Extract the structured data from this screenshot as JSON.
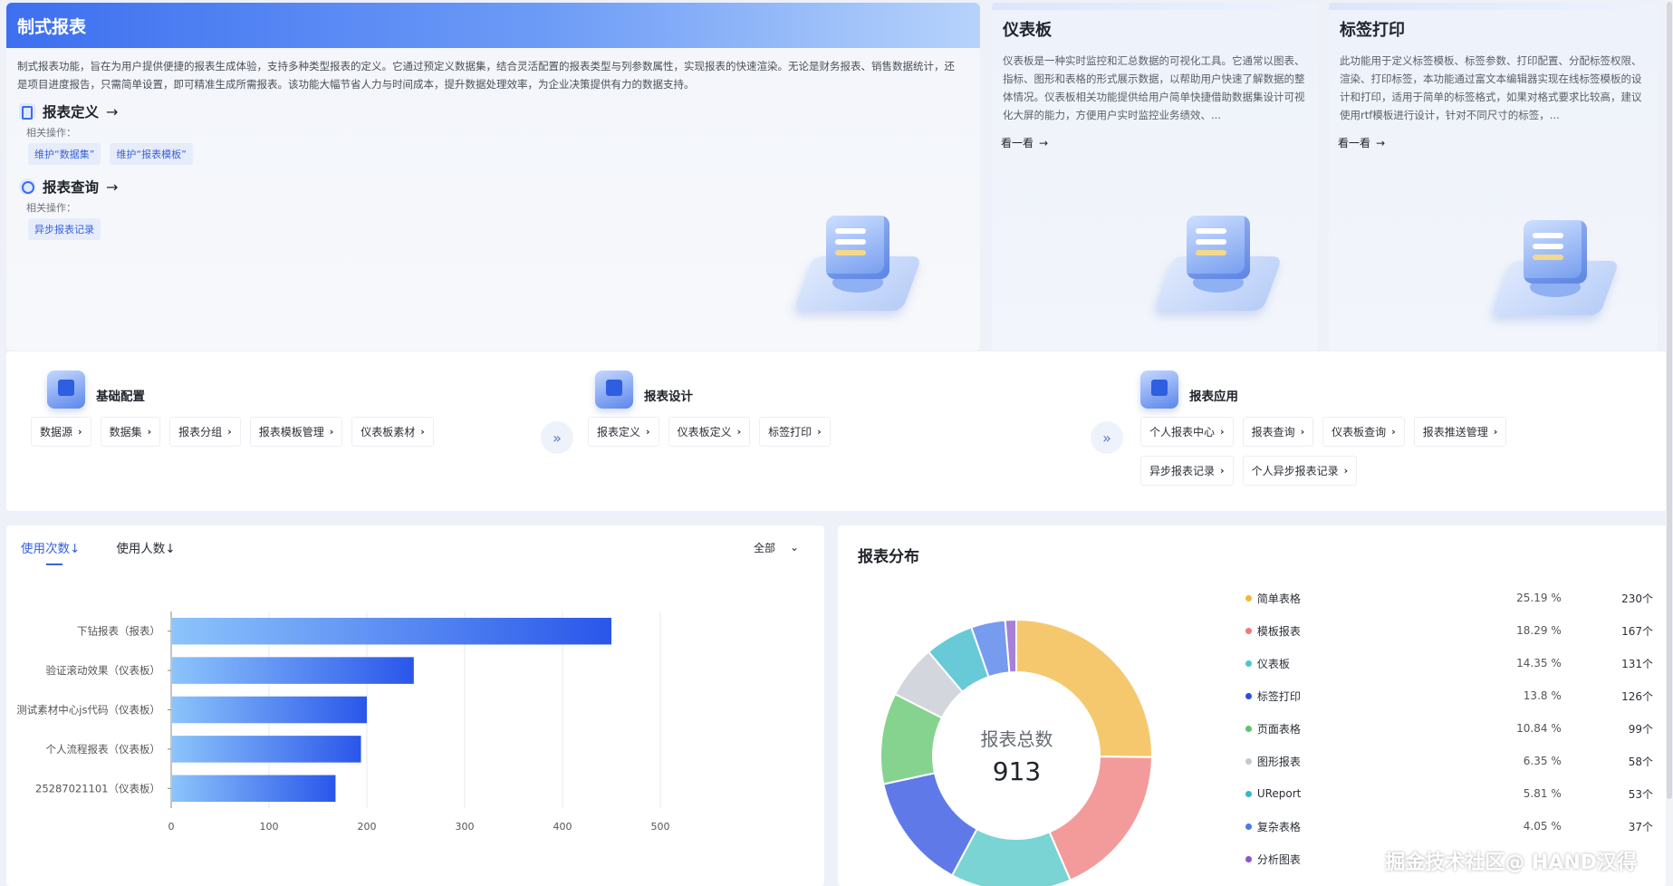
{
  "hero": {
    "title": "制式报表",
    "desc": "制式报表功能，旨在为用户提供便捷的报表生成体验，支持多种类型报表的定义。它通过预定义数据集，结合灵活配置的报表类型与列参数属性，实现报表的快速渲染。无论是财务报表、销售数据统计，还是项目进度报告，只需简单设置，即可精准生成所需报表。该功能大幅节省人力与时间成本，提升数据处理效率，为企业决策提供有力的数据支持。",
    "sections": [
      {
        "title": "报表定义",
        "arrow": "→",
        "sub": "相关操作：",
        "chips": [
          "维护“数据集”",
          "维护“报表模板”"
        ]
      },
      {
        "title": "报表查询",
        "arrow": "→",
        "sub": "相关操作：",
        "chips": [
          "异步报表记录"
        ]
      }
    ]
  },
  "cards": [
    {
      "title": "仪表板",
      "desc": "仪表板是一种实时监控和汇总数据的可视化工具。它通常以图表、指标、图形和表格的形式展示数据，以帮助用户快速了解数据的整体情况。仪表板相关功能提供给用户简单快捷借助数据集设计可视化大屏的能力，方便用户实时监控业务绩效、...",
      "link": "看一看",
      "arrow": "→"
    },
    {
      "title": "标签打印",
      "desc": "此功能用于定义标签模板、标签参数、打印配置、分配标签权限、渲染、打印标签，本功能通过富文本编辑器实现在线标签模板的设计和打印，适用于简单的标签格式，如果对格式要求比较高，建议使用rtf模板进行设计，针对不同尺寸的标签，...",
      "link": "看一看",
      "arrow": "→"
    }
  ],
  "nav": {
    "groups": [
      {
        "title": "基础配置",
        "items": [
          "数据源",
          "数据集",
          "报表分组",
          "报表模板管理",
          "仪表板素材"
        ]
      },
      {
        "title": "报表设计",
        "items": [
          "报表定义",
          "仪表板定义",
          "标签打印"
        ]
      },
      {
        "title": "报表应用",
        "items": [
          "个人报表中心",
          "报表查询",
          "仪表板查询",
          "报表推送管理",
          "异步报表记录",
          "个人异步报表记录"
        ]
      }
    ],
    "chevron": "›",
    "flow_glyph": "»"
  },
  "usage": {
    "tabs": [
      "使用次数",
      "使用人数"
    ],
    "tab_arrow": "↓",
    "select_value": "全部",
    "select_caret": "⌄"
  },
  "chart_data": {
    "type": "bar",
    "orientation": "horizontal",
    "categories": [
      "下钻报表（报表）",
      "验证滚动效果（仪表板）",
      "测试素材中心js代码（仪表板）",
      "个人流程报表（仪表板）",
      "25287021101（仪表板）"
    ],
    "values": [
      450,
      248,
      200,
      194,
      168
    ],
    "xlim": [
      0,
      500
    ],
    "xticks": [
      0,
      100,
      200,
      300,
      400,
      500
    ],
    "grid": true,
    "colors": {
      "bar_start": "#8cc4fb",
      "bar_end": "#2a56ea"
    }
  },
  "distribution": {
    "title": "报表分布",
    "center_label": "报表总数",
    "center_value": "913",
    "items": [
      {
        "name": "简单表格",
        "pct": "25.19 %",
        "count": "230个",
        "color": "#f3b63e",
        "value": 230
      },
      {
        "name": "模板报表",
        "pct": "18.29 %",
        "count": "167个",
        "color": "#ef7a7a",
        "value": 167
      },
      {
        "name": "仪表板",
        "pct": "14.35 %",
        "count": "131个",
        "color": "#4fc6c6",
        "value": 131
      },
      {
        "name": "标签打印",
        "pct": "13.8 %",
        "count": "126个",
        "color": "#2a4ee0",
        "value": 126
      },
      {
        "name": "页面表格",
        "pct": "10.84 %",
        "count": "99个",
        "color": "#5ec46a",
        "value": 99
      },
      {
        "name": "图形报表",
        "pct": "6.35 %",
        "count": "58个",
        "color": "#c4c8d0",
        "value": 58
      },
      {
        "name": "UReport",
        "pct": "5.81 %",
        "count": "53个",
        "color": "#36b8c8",
        "value": 53
      },
      {
        "name": "复杂表格",
        "pct": "4.05 %",
        "count": "37个",
        "color": "#4a7ae8",
        "value": 37
      },
      {
        "name": "分析图表",
        "pct": "",
        "count": "",
        "color": "#8a55c9",
        "value": 12
      }
    ]
  },
  "corner_mark": "掘金技术社区@ HAND汉得"
}
